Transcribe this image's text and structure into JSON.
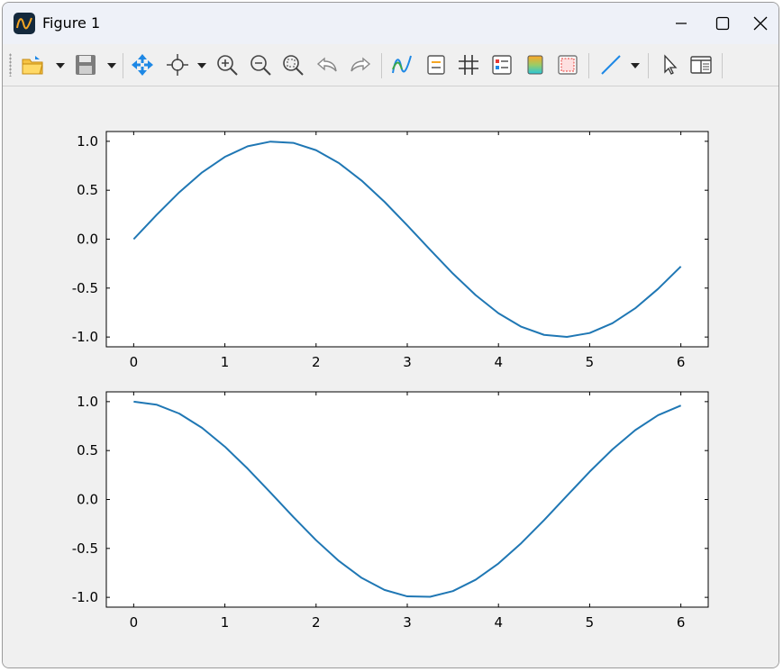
{
  "window": {
    "title": "Figure 1",
    "app_icon": "matplotlib-figure-icon"
  },
  "toolbar": {
    "buttons": [
      {
        "name": "open-folder-icon",
        "dropdown": true
      },
      {
        "name": "save-icon",
        "dropdown": true
      },
      {
        "name": "pan-icon",
        "dropdown": false
      },
      {
        "name": "data-cursor-icon",
        "dropdown": true
      },
      {
        "name": "zoom-in-icon",
        "dropdown": false
      },
      {
        "name": "zoom-out-icon",
        "dropdown": false
      },
      {
        "name": "zoom-fit-icon",
        "dropdown": false
      },
      {
        "name": "undo-icon",
        "dropdown": false
      },
      {
        "name": "redo-icon",
        "dropdown": false
      },
      {
        "name": "line-style-icon",
        "dropdown": false
      },
      {
        "name": "legend-icon",
        "dropdown": false
      },
      {
        "name": "grid-icon",
        "dropdown": false
      },
      {
        "name": "properties-icon",
        "dropdown": false
      },
      {
        "name": "colorbar-icon",
        "dropdown": false
      },
      {
        "name": "frame-icon",
        "dropdown": false
      },
      {
        "name": "line-tool-icon",
        "dropdown": true
      },
      {
        "name": "select-pointer-icon",
        "dropdown": false
      },
      {
        "name": "panel-layout-icon",
        "dropdown": false
      }
    ]
  },
  "colors": {
    "line": "#1f77b4",
    "toolbar_blue": "#1e88e5",
    "window_bg": "#f0f0f0"
  },
  "chart_data": [
    {
      "type": "line",
      "title": "",
      "xlabel": "",
      "ylabel": "",
      "xlim": [
        -0.3,
        6.3
      ],
      "ylim": [
        -1.1,
        1.1
      ],
      "xticks": [
        "0",
        "1",
        "2",
        "3",
        "4",
        "5",
        "6"
      ],
      "yticks": [
        "1.0",
        "0.5",
        "0.0",
        "-0.5",
        "-1.0"
      ],
      "grid": false,
      "series": [
        {
          "x": [
            0,
            0.25,
            0.5,
            0.75,
            1.0,
            1.25,
            1.5,
            1.75,
            2.0,
            2.25,
            2.5,
            2.75,
            3.0,
            3.25,
            3.5,
            3.75,
            4.0,
            4.25,
            4.5,
            4.75,
            5.0,
            5.25,
            5.5,
            5.75,
            6.0
          ],
          "y": [
            0.0,
            0.247,
            0.479,
            0.682,
            0.841,
            0.949,
            0.997,
            0.984,
            0.909,
            0.778,
            0.598,
            0.382,
            0.141,
            -0.108,
            -0.351,
            -0.572,
            -0.757,
            -0.895,
            -0.978,
            -0.999,
            -0.959,
            -0.859,
            -0.706,
            -0.508,
            -0.279
          ]
        }
      ]
    },
    {
      "type": "line",
      "title": "",
      "xlabel": "",
      "ylabel": "",
      "xlim": [
        -0.3,
        6.3
      ],
      "ylim": [
        -1.1,
        1.1
      ],
      "xticks": [
        "0",
        "1",
        "2",
        "3",
        "4",
        "5",
        "6"
      ],
      "yticks": [
        "1.0",
        "0.5",
        "0.0",
        "-0.5",
        "-1.0"
      ],
      "grid": false,
      "series": [
        {
          "x": [
            0,
            0.25,
            0.5,
            0.75,
            1.0,
            1.25,
            1.5,
            1.75,
            2.0,
            2.25,
            2.5,
            2.75,
            3.0,
            3.25,
            3.5,
            3.75,
            4.0,
            4.25,
            4.5,
            4.75,
            5.0,
            5.25,
            5.5,
            5.75,
            6.0
          ],
          "y": [
            1.0,
            0.969,
            0.878,
            0.732,
            0.54,
            0.315,
            0.071,
            -0.178,
            -0.416,
            -0.628,
            -0.801,
            -0.924,
            -0.99,
            -0.994,
            -0.936,
            -0.82,
            -0.654,
            -0.446,
            -0.211,
            0.037,
            0.284,
            0.512,
            0.709,
            0.861,
            0.96
          ]
        }
      ]
    }
  ]
}
